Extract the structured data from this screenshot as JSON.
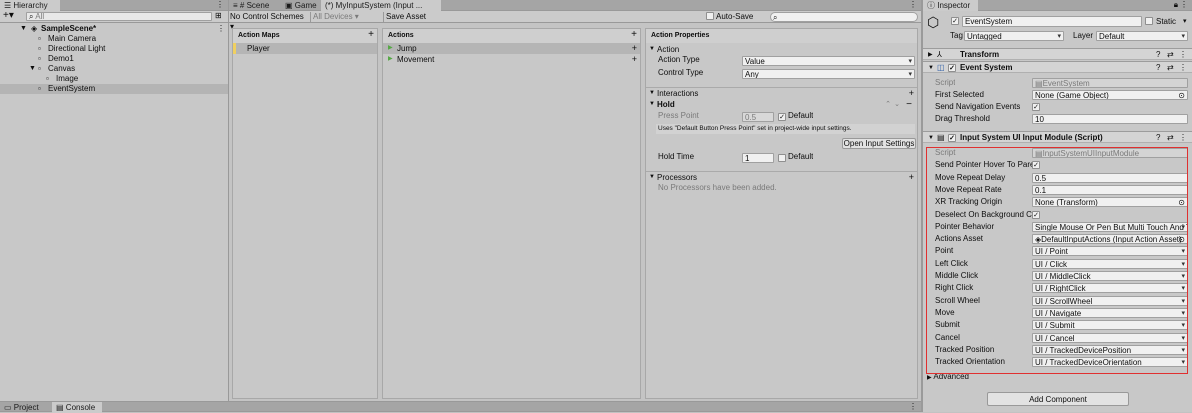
{
  "hierarchy": {
    "tab_label": "Hierarchy",
    "search_placeholder": "All",
    "items": [
      {
        "label": "SampleScene*"
      },
      {
        "label": "Main Camera"
      },
      {
        "label": "Directional Light"
      },
      {
        "label": "Demo1"
      },
      {
        "label": "Canvas"
      },
      {
        "label": "Image"
      },
      {
        "label": "EventSystem"
      }
    ]
  },
  "center": {
    "tabs": [
      {
        "label": "Scene"
      },
      {
        "label": "Game"
      },
      {
        "label": "(*) MyInputSystem (Input ..."
      }
    ],
    "control_schemes": "No Control Schemes",
    "devices": "All Devices",
    "save_asset": "Save Asset",
    "auto_save": "Auto-Save",
    "action_maps": {
      "header": "Action Maps",
      "items": [
        "Player"
      ]
    },
    "actions": {
      "header": "Actions",
      "items": [
        "Jump",
        "Movement"
      ]
    },
    "props": {
      "header": "Action Properties",
      "action_section": "Action",
      "action_type_label": "Action Type",
      "action_type_value": "Value",
      "control_type_label": "Control Type",
      "control_type_value": "Any",
      "interactions_section": "Interactions",
      "hold_label": "Hold",
      "press_point_label": "Press Point",
      "press_point_value": "0.5",
      "default_label": "Default",
      "uses_note": "Uses \"Default Button Press Point\" set in project-wide input settings.",
      "open_settings": "Open Input Settings",
      "hold_time_label": "Hold Time",
      "hold_time_value": "1",
      "hold_default_label": "Default",
      "processors_section": "Processors",
      "no_processors": "No Processors have been added."
    }
  },
  "inspector": {
    "tab_label": "Inspector",
    "object_name": "EventSystem",
    "static_label": "Static",
    "tag_label": "Tag",
    "tag_value": "Untagged",
    "layer_label": "Layer",
    "layer_value": "Default",
    "transform_label": "Transform",
    "event_system_label": "Event System",
    "es_rows": [
      {
        "label": "Script",
        "value": "EventSystem"
      },
      {
        "label": "First Selected",
        "value": "None (Game Object)"
      },
      {
        "label": "Send Navigation Events",
        "value": ""
      },
      {
        "label": "Drag Threshold",
        "value": "10"
      }
    ],
    "module_label": "Input System UI Input Module (Script)",
    "module_rows": [
      {
        "label": "Script",
        "value": "InputSystemUIInputModule"
      },
      {
        "label": "Send Pointer Hover To Parent",
        "value": ""
      },
      {
        "label": "Move Repeat Delay",
        "value": "0.5"
      },
      {
        "label": "Move Repeat Rate",
        "value": "0.1"
      },
      {
        "label": "XR Tracking Origin",
        "value": "None (Transform)"
      },
      {
        "label": "Deselect On Background Click",
        "value": ""
      },
      {
        "label": "Pointer Behavior",
        "value": "Single Mouse Or Pen But Multi Touch And Track"
      },
      {
        "label": "Actions Asset",
        "value": "DefaultInputActions (Input Action Asset)"
      },
      {
        "label": "Point",
        "value": "UI / Point"
      },
      {
        "label": "Left Click",
        "value": "UI / Click"
      },
      {
        "label": "Middle Click",
        "value": "UI / MiddleClick"
      },
      {
        "label": "Right Click",
        "value": "UI / RightClick"
      },
      {
        "label": "Scroll Wheel",
        "value": "UI / ScrollWheel"
      },
      {
        "label": "Move",
        "value": "UI / Navigate"
      },
      {
        "label": "Submit",
        "value": "UI / Submit"
      },
      {
        "label": "Cancel",
        "value": "UI / Cancel"
      },
      {
        "label": "Tracked Position",
        "value": "UI / TrackedDevicePosition"
      },
      {
        "label": "Tracked Orientation",
        "value": "UI / TrackedDeviceOrientation"
      }
    ],
    "advanced_label": "Advanced",
    "add_component": "Add Component"
  },
  "bottom": {
    "tabs": [
      {
        "label": "Project"
      },
      {
        "label": "Console"
      }
    ]
  },
  "colors": {
    "highlight_box": "#e03030",
    "accent_map": "#f0d060"
  }
}
